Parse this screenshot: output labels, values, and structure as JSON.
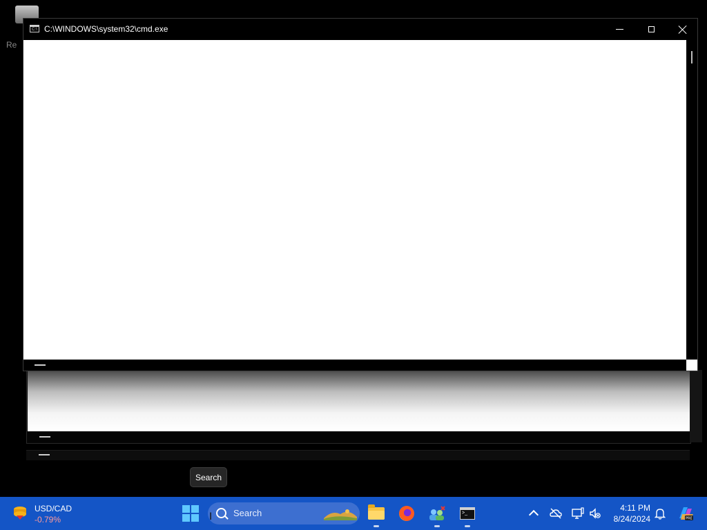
{
  "desktop": {
    "icon_label_fragment": "Re"
  },
  "window": {
    "title": "C:\\WINDOWS\\system32\\cmd.exe",
    "icon_text": "C:\\"
  },
  "tooltip": {
    "text": "Search"
  },
  "taskbar": {
    "widget": {
      "title": "USD/CAD",
      "value": "-0.79%",
      "value_color": "#ff9a9a"
    },
    "search": {
      "placeholder": "Search"
    },
    "clock": {
      "time": "4:11 PM",
      "date": "8/24/2024"
    },
    "accent": "#1455c6",
    "apps": [
      "file-explorer",
      "firefox",
      "people-app",
      "terminal"
    ]
  }
}
